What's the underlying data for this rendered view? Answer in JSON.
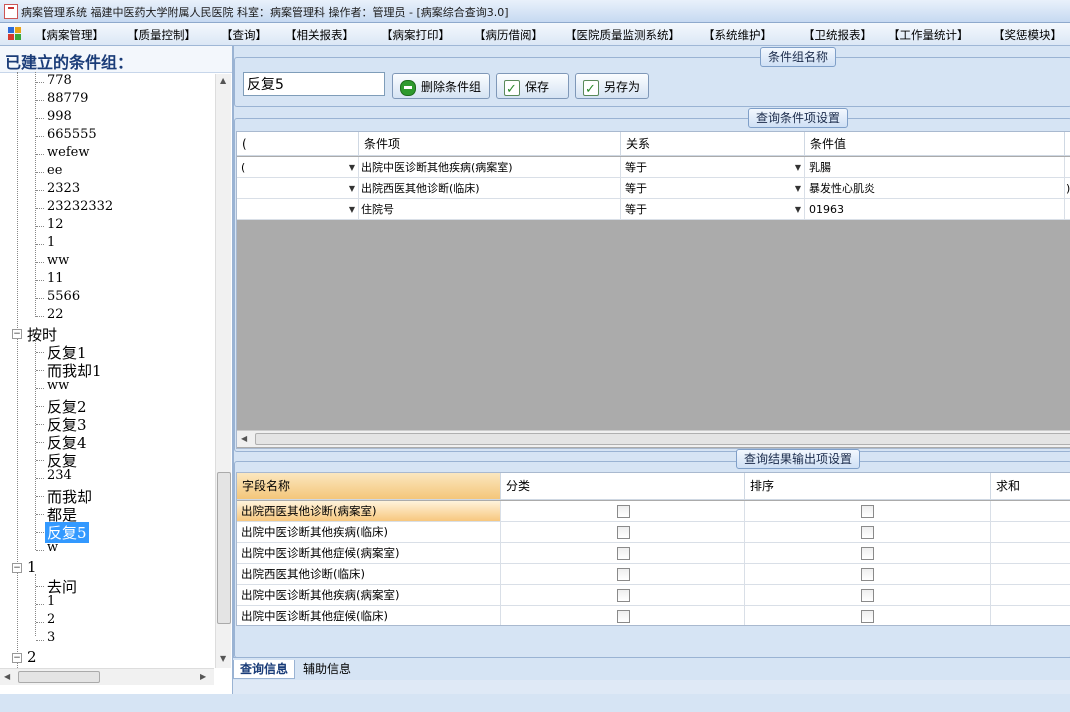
{
  "window": {
    "title": "病案管理系统  福建中医药大学附属人民医院  科室：病案管理科 操作者：管理员 - [病案综合查询3.0]"
  },
  "menu": [
    "【病案管理】",
    "【质量控制】",
    "【查询】",
    "【相关报表】",
    "【病案打印】",
    "【病历借阅】",
    "【医院质量监测系统】",
    "【系统维护】",
    "【卫统报表】",
    "【工作量统计】",
    "【奖惩模块】"
  ],
  "left": {
    "header": "已建立的条件组：",
    "group_a_items": [
      "778",
      "88779",
      "998",
      "665555",
      "wefew",
      "ee",
      "2323",
      "23232332",
      "12",
      "1",
      "ww",
      "11",
      "5566",
      "22"
    ],
    "group_b_label": "按时",
    "group_b_items": [
      "反复1",
      "而我却1",
      "ww",
      "反复2",
      "反复3",
      "反复4",
      "反复",
      "234",
      "而我却",
      "都是",
      "反复5",
      "w"
    ],
    "group_b_selected": "反复5",
    "group_c_label": "1",
    "group_c_items": [
      "去问",
      "1",
      "2",
      "3"
    ],
    "group_d_label": "2"
  },
  "condition_group": {
    "legend": "条件组名称",
    "name_value": "反复5",
    "delete_label": "删除条件组",
    "save_label": "保存",
    "saveas_label": "另存为"
  },
  "query_conditions": {
    "legend": "查询条件项设置",
    "columns": [
      "(",
      "条件项",
      "关系",
      "条件值"
    ],
    "rows": [
      {
        "paren": "(",
        "item": "出院中医诊断其他疾病(病案室)",
        "relation": "等于",
        "value": "乳腸",
        "close": ""
      },
      {
        "paren": "",
        "item": "出院西医其他诊断(临床)",
        "relation": "等于",
        "value": "暴发性心肌炎",
        "close": ")"
      },
      {
        "paren": "",
        "item": "住院号",
        "relation": "等于",
        "value": "01963",
        "close": ""
      }
    ]
  },
  "output_settings": {
    "legend": "查询结果输出项设置",
    "columns": [
      "字段名称",
      "分类",
      "排序",
      "求和"
    ],
    "rows": [
      "出院西医其他诊断(病案室)",
      "出院中医诊断其他疾病(临床)",
      "出院中医诊断其他症候(病案室)",
      "出院西医其他诊断(临床)",
      "出院中医诊断其他疾病(病案室)",
      "出院中医诊断其他症候(临床)"
    ]
  },
  "tabs": [
    "查询信息",
    "辅助信息"
  ],
  "colors": {
    "selection": "#3399ff",
    "header_highlight": "#f9d9a0",
    "row_highlight": "#f7c77e"
  }
}
